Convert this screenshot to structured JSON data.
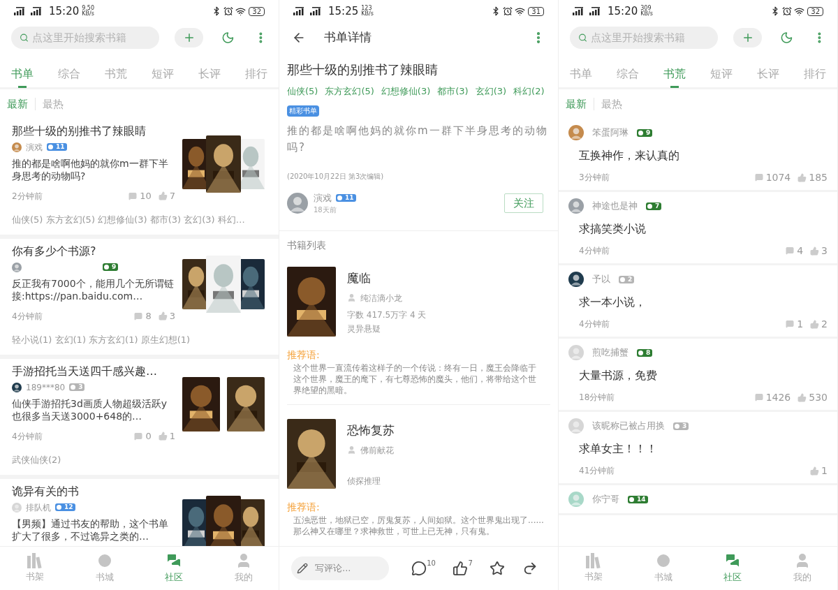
{
  "screens": [
    {
      "kind": "list",
      "status_bar": {
        "time": "15:20",
        "speed": "9.50",
        "speed_unit": "KB/s",
        "battery": "32"
      },
      "search": {
        "placeholder": "点这里开始搜索书籍"
      },
      "tabs": [
        {
          "label": "书单",
          "selected": true
        },
        {
          "label": "综合",
          "selected": false
        },
        {
          "label": "书荒",
          "selected": false
        },
        {
          "label": "短评",
          "selected": false
        },
        {
          "label": "长评",
          "selected": false
        },
        {
          "label": "排行",
          "selected": false
        }
      ],
      "sort": [
        {
          "label": "最新",
          "selected": true
        },
        {
          "label": "最热",
          "selected": false
        }
      ],
      "posts": [
        {
          "title": "那些十级的别推书了辣眼睛",
          "author": "演戏",
          "level": "11",
          "color": "#4a90e2",
          "body": "推的都是啥啊他妈的就你m一群下半身思考的动物吗?",
          "time": "2分钟前",
          "comments": "10",
          "likes": "7",
          "tags": "仙侠(5) 东方玄幻(5) 幻想修仙(3) 都市(3) 玄幻(3) 科幻…"
        },
        {
          "title": "你有多少个书源?",
          "level": "9",
          "color": "#2e7d32",
          "body": "反正我有7000个，能用几个无所谓链接:https://pan.baidu.com…",
          "time": "4分钟前",
          "comments": "8",
          "likes": "3",
          "tags": "轻小说(1) 玄幻(1) 东方玄幻(1) 原生幻想(1)"
        },
        {
          "title": "手游招托当天送四千感兴趣…",
          "author": "189***80",
          "level": "3",
          "color": "#b5b5b5",
          "body": "仙侠手游招托3d画质人物超级活跃y也很多当天送3000+648的…",
          "time": "4分钟前",
          "comments": "0",
          "likes": "1",
          "tags": "武侠仙侠(2)"
        },
        {
          "title": "诡异有关的书",
          "author": "排队机",
          "level": "12",
          "color": "#4a90e2",
          "body": "【男频】通过书友的帮助，这个书单扩大了很多，不过诡异之类的…"
        }
      ],
      "nav": [
        {
          "label": "书架",
          "selected": false
        },
        {
          "label": "书城",
          "selected": false
        },
        {
          "label": "社区",
          "selected": true
        },
        {
          "label": "我的",
          "selected": false
        }
      ]
    },
    {
      "kind": "detail",
      "status_bar": {
        "time": "15:25",
        "speed": "123",
        "speed_unit": "KB/s",
        "battery": "31"
      },
      "header": {
        "title": "书单详情"
      },
      "title": "那些十级的别推书了辣眼睛",
      "tags": [
        "仙侠(5)",
        "东方玄幻(5)",
        "幻想修仙(3)",
        "都市(3)",
        "玄幻(3)",
        "科幻(2)"
      ],
      "badge": "精彩书单",
      "description": "推的都是啥啊他妈的就你m一群下半身思考的动物吗?",
      "edit_note": "(2020年10月22日 第3次编辑)",
      "author": {
        "name": "演戏",
        "level": "11",
        "color": "#4a90e2",
        "time": "18天前"
      },
      "follow_button": "关注",
      "section_title": "书籍列表",
      "books": [
        {
          "name": "魔临",
          "author": "纯洁滴小龙",
          "info": "字数 417.5万字  4 天",
          "genre": "灵异悬疑",
          "rec_label": "推荐语:",
          "rec": "这个世界一直流传着这样子的一个传说：终有一日，魔王会降临于这个世界，魔王的麾下，有七尊恐怖的魔头，他们，将带给这个世界绝望的黑暗。"
        },
        {
          "name": "恐怖复苏",
          "author": "佛前献花",
          "genre": "侦探推理",
          "rec_label": "推荐语:",
          "rec": "五浊恶世，地狱已空，厉鬼复苏，人间如狱。这个世界鬼出现了......那么神又在哪里？求神救世，可世上已无神，只有鬼。"
        }
      ],
      "bottom_bar": {
        "placeholder": "写评论...",
        "comments": "10",
        "likes": "7"
      }
    },
    {
      "kind": "list",
      "status_bar": {
        "time": "15:20",
        "speed": "309",
        "speed_unit": "KB/s",
        "battery": "32"
      },
      "search": {
        "placeholder": "点这里开始搜索书籍"
      },
      "tabs": [
        {
          "label": "书单",
          "selected": false
        },
        {
          "label": "综合",
          "selected": false
        },
        {
          "label": "书荒",
          "selected": true
        },
        {
          "label": "短评",
          "selected": false
        },
        {
          "label": "长评",
          "selected": false
        },
        {
          "label": "排行",
          "selected": false
        }
      ],
      "sort": [
        {
          "label": "最新",
          "selected": true
        },
        {
          "label": "最热",
          "selected": false
        }
      ],
      "requests": [
        {
          "author": "笨蛋阿琳",
          "level": "9",
          "color": "#2e7d32",
          "text": "互换神作，来认真的",
          "time": "3分钟前",
          "comments": "1074",
          "likes": "185"
        },
        {
          "author": "神途也是神",
          "level": "7",
          "color": "#2e7d32",
          "text": "求搞笑类小说",
          "time": "4分钟前",
          "comments": "4",
          "likes": "3"
        },
        {
          "author": "予以",
          "level": "2",
          "color": "#b5b5b5",
          "text": "求一本小说，",
          "time": "4分钟前",
          "comments": "1",
          "likes": "2"
        },
        {
          "author": "煎吃捕蟹",
          "level": "8",
          "color": "#2e7d32",
          "text": "大量书源，免费",
          "time": "18分钟前",
          "comments": "1426",
          "likes": "530"
        },
        {
          "author": "该昵称已被占用换",
          "level": "3",
          "color": "#b5b5b5",
          "text": "求单女主！！！",
          "time": "41分钟前",
          "likes": "1"
        },
        {
          "author": "你宁哥",
          "level": "14",
          "color": "#2e7d32"
        }
      ],
      "nav": [
        {
          "label": "书架",
          "selected": false
        },
        {
          "label": "书城",
          "selected": false
        },
        {
          "label": "社区",
          "selected": true
        },
        {
          "label": "我的",
          "selected": false
        }
      ]
    }
  ]
}
